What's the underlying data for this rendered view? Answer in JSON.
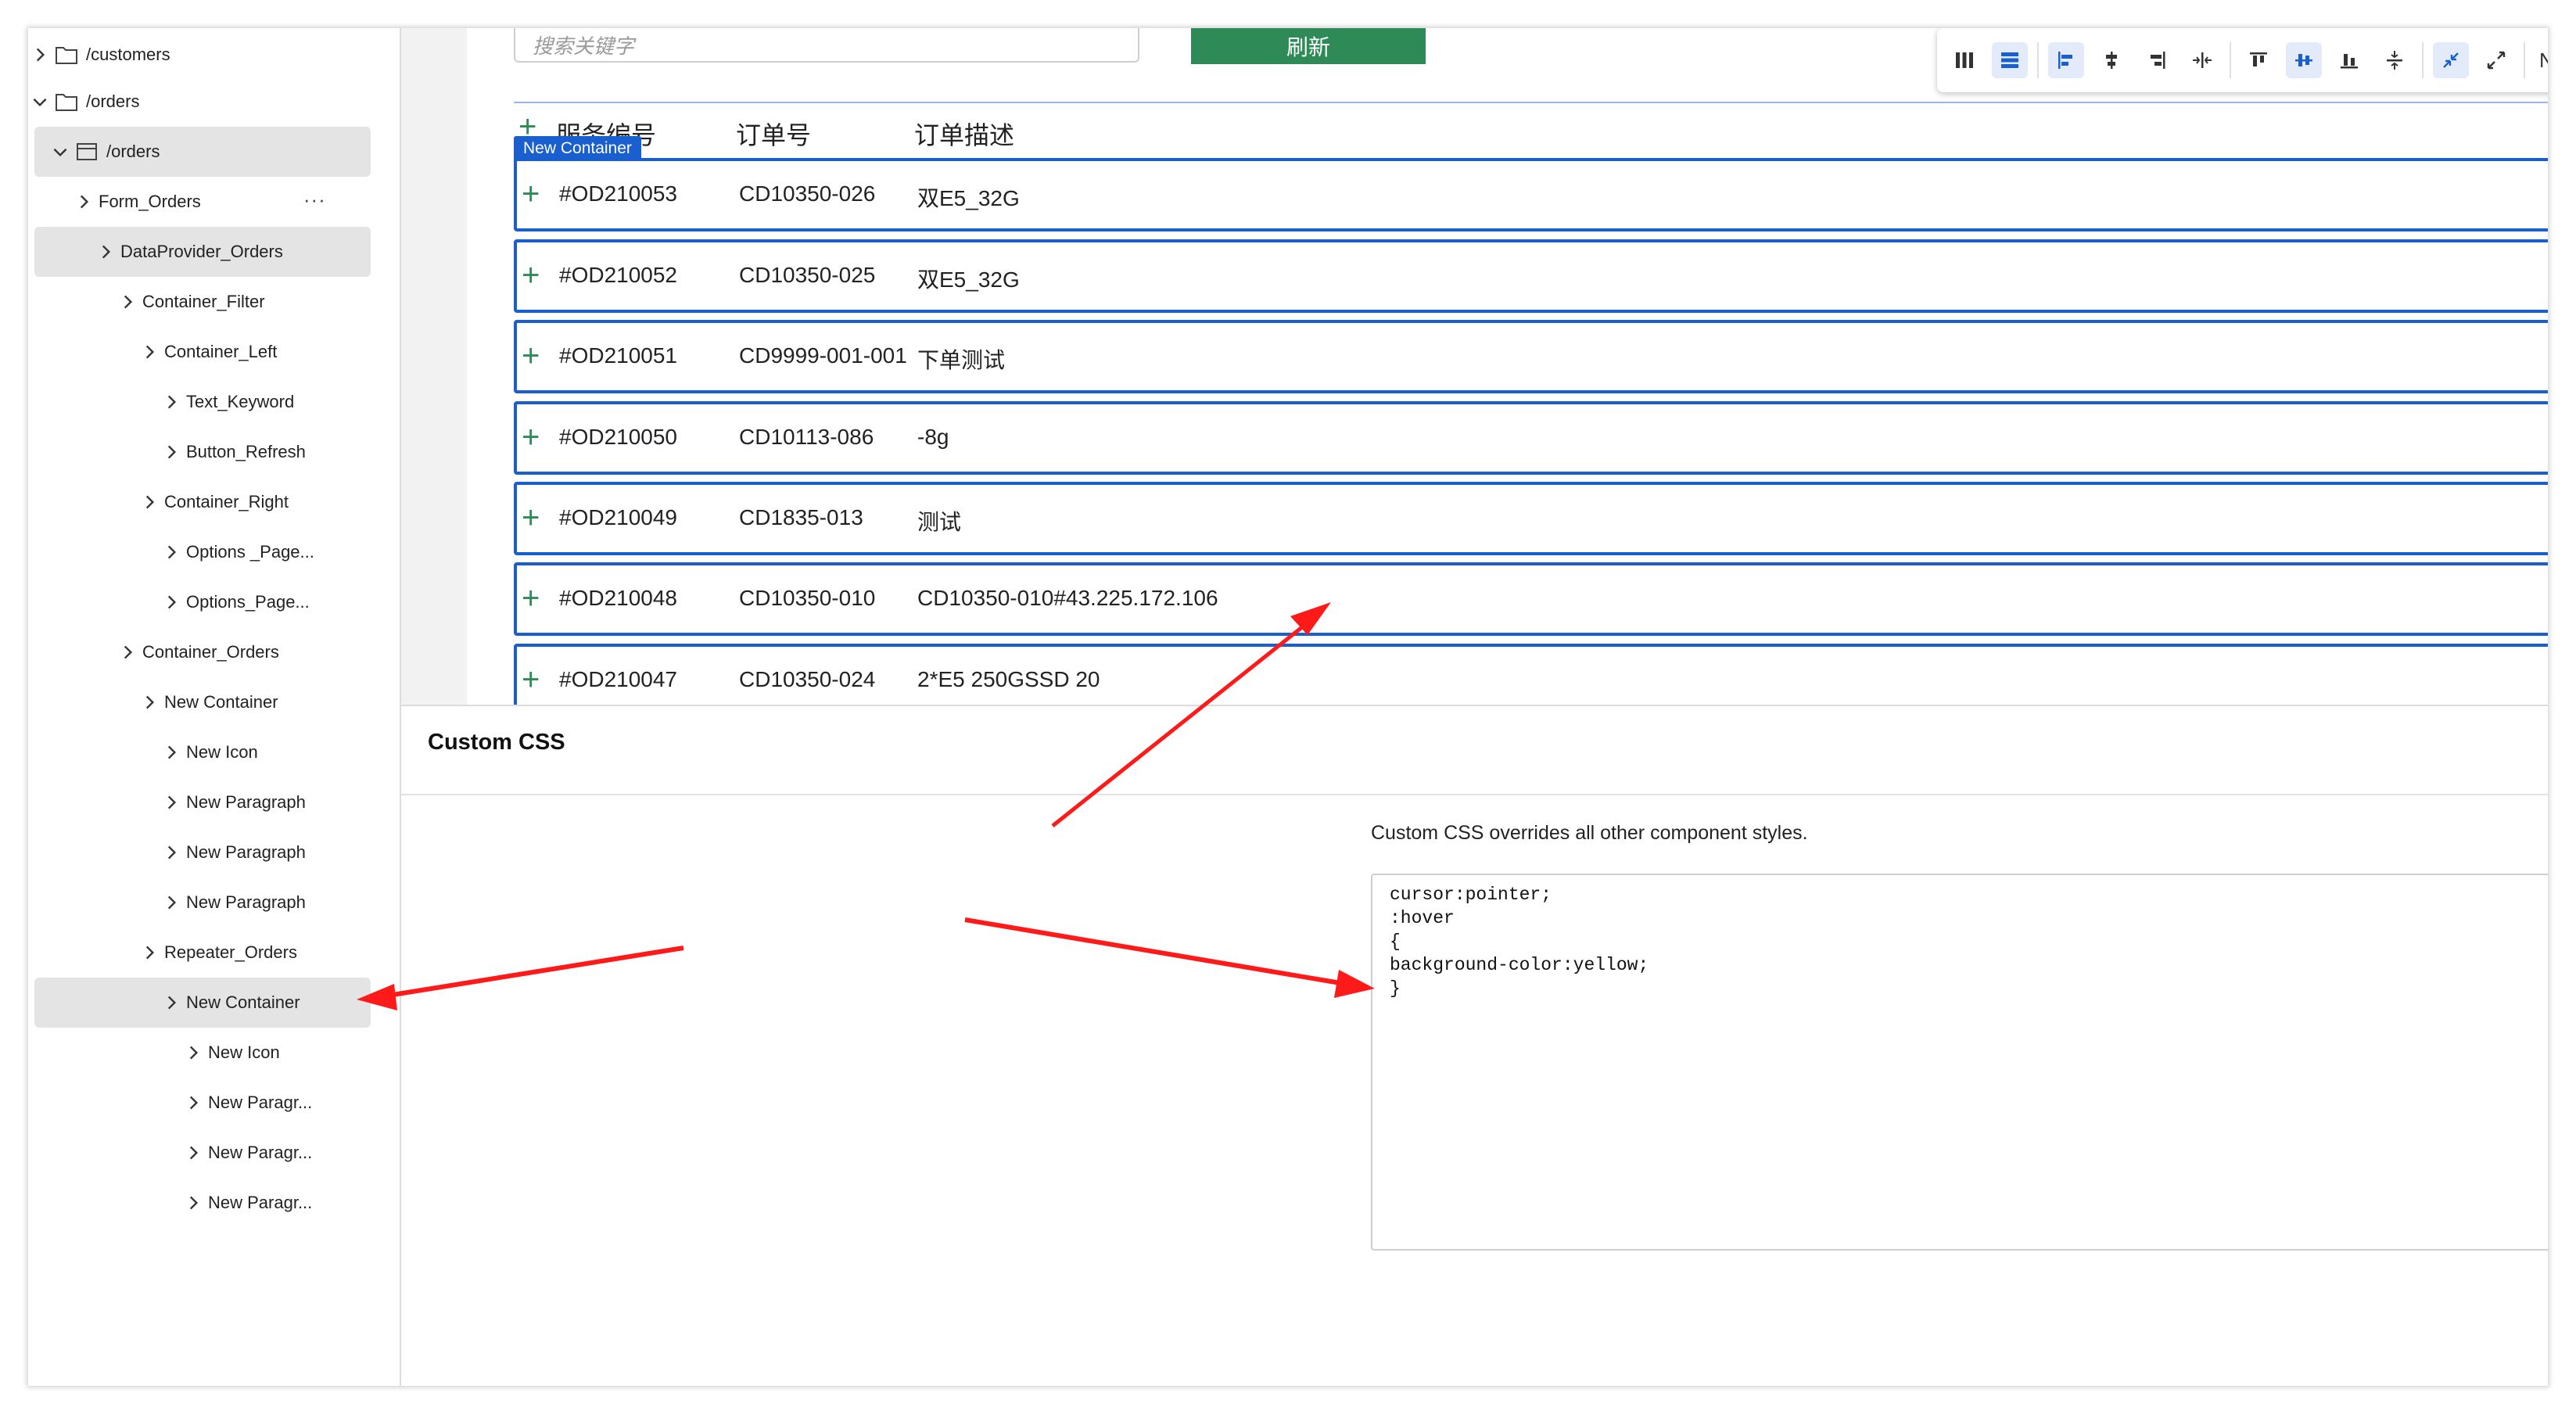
{
  "sidebar": {
    "items": [
      {
        "label": "/customers",
        "kind": "folder"
      },
      {
        "label": "/orders",
        "kind": "folder"
      },
      {
        "label": "/orders",
        "kind": "page"
      },
      {
        "label": "Form_Orders",
        "more": "···"
      },
      {
        "label": "DataProvider_Orders"
      },
      {
        "label": "Container_Filter"
      },
      {
        "label": "Container_Left"
      },
      {
        "label": "Text_Keyword"
      },
      {
        "label": "Button_Refresh"
      },
      {
        "label": "Container_Right"
      },
      {
        "label": "Options _Page..."
      },
      {
        "label": "Options_Page..."
      },
      {
        "label": "Container_Orders"
      },
      {
        "label": "New Container"
      },
      {
        "label": "New Icon"
      },
      {
        "label": "New Paragraph"
      },
      {
        "label": "New Paragraph"
      },
      {
        "label": "New Paragraph"
      },
      {
        "label": "Repeater_Orders"
      },
      {
        "label": "New Container"
      },
      {
        "label": "New Icon"
      },
      {
        "label": "New Paragr..."
      },
      {
        "label": "New Paragr..."
      },
      {
        "label": "New Paragr..."
      }
    ]
  },
  "canvas": {
    "search_placeholder": "搜索关键字",
    "refresh_label": "刷新",
    "selected_tag": "New Container",
    "columns": [
      "服务编号",
      "订单号",
      "订单描述"
    ],
    "rows": [
      {
        "id": "#OD210053",
        "order": "CD10350-026",
        "desc": "双E5_32G"
      },
      {
        "id": "#OD210052",
        "order": "CD10350-025",
        "desc": "双E5_32G"
      },
      {
        "id": "#OD210051",
        "order": "CD9999-001-001",
        "desc": "下单测试"
      },
      {
        "id": "#OD210050",
        "order": "CD10113-086",
        "desc": "-8g"
      },
      {
        "id": "#OD210049",
        "order": "CD1835-013",
        "desc": "测试"
      },
      {
        "id": "#OD210048",
        "order": "CD10350-010",
        "desc": "CD10350-010#43.225.172.106"
      },
      {
        "id": "#OD210047",
        "order": "CD10350-024",
        "desc": "2*E5 250GSSD 20"
      }
    ]
  },
  "toolbar": {
    "select_value": "None",
    "accent": "#1a5fd0"
  },
  "panel": {
    "title": "Custom CSS",
    "help_text": "Custom CSS overrides all other component styles.",
    "css_code": "cursor:pointer;\n:hover\n{\nbackground-color:yellow;\n}"
  },
  "colors": {
    "row_border": "#1a5fd0",
    "refresh_bg": "#2e8b57",
    "arrow": "#ff1a1a"
  }
}
